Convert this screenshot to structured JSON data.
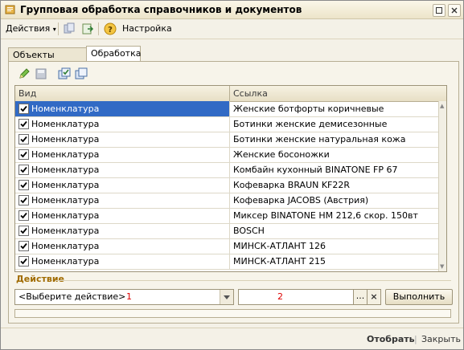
{
  "window": {
    "title": "Групповая обработка справочников и документов"
  },
  "toolbar": {
    "actions_label": "Действия",
    "settings_label": "Настройка"
  },
  "tabs": [
    {
      "label": "Объекты отбора"
    },
    {
      "label": "Обработка"
    }
  ],
  "table": {
    "columns": [
      "Вид",
      "Ссылка"
    ],
    "rows": [
      {
        "kind": "Номенклатура",
        "ref": "Женские ботфорты коричневые",
        "checked": true
      },
      {
        "kind": "Номенклатура",
        "ref": "Ботинки женские демисезонные",
        "checked": true
      },
      {
        "kind": "Номенклатура",
        "ref": "Ботинки женские натуральная кожа",
        "checked": true
      },
      {
        "kind": "Номенклатура",
        "ref": "Женские босоножки",
        "checked": true
      },
      {
        "kind": "Номенклатура",
        "ref": "Комбайн кухонный BINATONE FP 67",
        "checked": true
      },
      {
        "kind": "Номенклатура",
        "ref": "Кофеварка BRAUN KF22R",
        "checked": true
      },
      {
        "kind": "Номенклатура",
        "ref": "Кофеварка JACOBS (Австрия)",
        "checked": true
      },
      {
        "kind": "Номенклатура",
        "ref": "Миксер BINATONE HM 212,6 скор. 150вт",
        "checked": true
      },
      {
        "kind": "Номенклатура",
        "ref": "BOSCH",
        "checked": true
      },
      {
        "kind": "Номенклатура",
        "ref": "МИНСК-АТЛАНТ 126",
        "checked": true
      },
      {
        "kind": "Номенклатура",
        "ref": "МИНСК-АТЛАНТ 215",
        "checked": true
      }
    ]
  },
  "action": {
    "section_label": "Действие",
    "select_value": "<Выберите действие>",
    "select_marker": "1",
    "param_marker": "2",
    "dots_label": "...",
    "clear_label": "×",
    "run_label": "Выполнить"
  },
  "footer": {
    "select_label": "Отобрать",
    "close_label": "Закрыть",
    "separator": "|"
  },
  "colors": {
    "selected_row": "#316ac5",
    "section_label": "#a06b00",
    "marker": "#dd0000"
  }
}
